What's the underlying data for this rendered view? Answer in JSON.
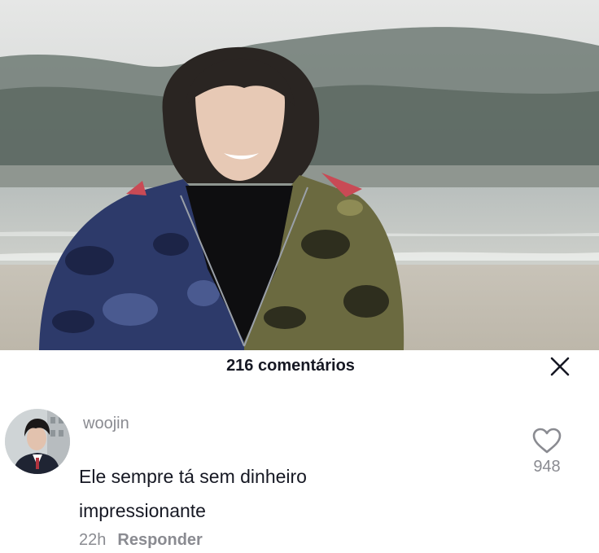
{
  "video": {
    "description_icon": "video-frame"
  },
  "comments_sheet": {
    "count_label": "216 comentários",
    "close_icon": "close-x-icon"
  },
  "comment": {
    "username": "woojin",
    "text_line1": "Ele sempre tá sem dinheiro",
    "text_line2": "impressionante",
    "time": "22h",
    "reply_label": "Responder",
    "like_count": "948",
    "like_icon": "heart-outline-icon"
  },
  "colors": {
    "primary_text": "#161823",
    "secondary_text": "#8a8b91"
  }
}
